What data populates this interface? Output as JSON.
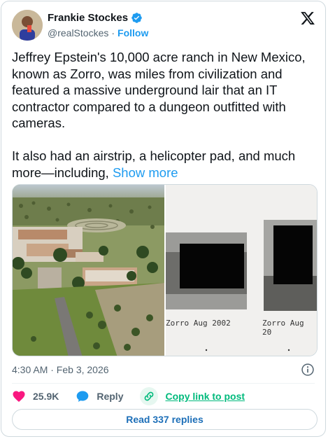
{
  "author": {
    "name": "Frankie Stockes",
    "handle": "@realStockes",
    "separator": "·",
    "follow_label": "Follow"
  },
  "tweet": {
    "text": "Jeffrey Epstein's 10,000 acre ranch in New Mexico, known as Zorro, was miles from civilization and featured a massive underground lair that an IT contractor compared to a dungeon outfitted with cameras.\n\nIt also had an airstrip, a helicopter pad, and much more—including, ",
    "show_more_label": "Show more"
  },
  "media": {
    "left_alt": "aerial-ranch-photo",
    "right_label_1": "Zorro  Aug 2002",
    "right_label_2": "Zorro  Aug 20"
  },
  "meta": {
    "timestamp": "4:30 AM · Feb 3, 2026"
  },
  "actions": {
    "like_count": "25.9K",
    "reply_label": "Reply",
    "copy_label": "Copy link to post"
  },
  "replies_button": "Read 337 replies",
  "colors": {
    "accent": "#1d9bf0",
    "like": "#f91880",
    "copy": "#00ba7c"
  }
}
